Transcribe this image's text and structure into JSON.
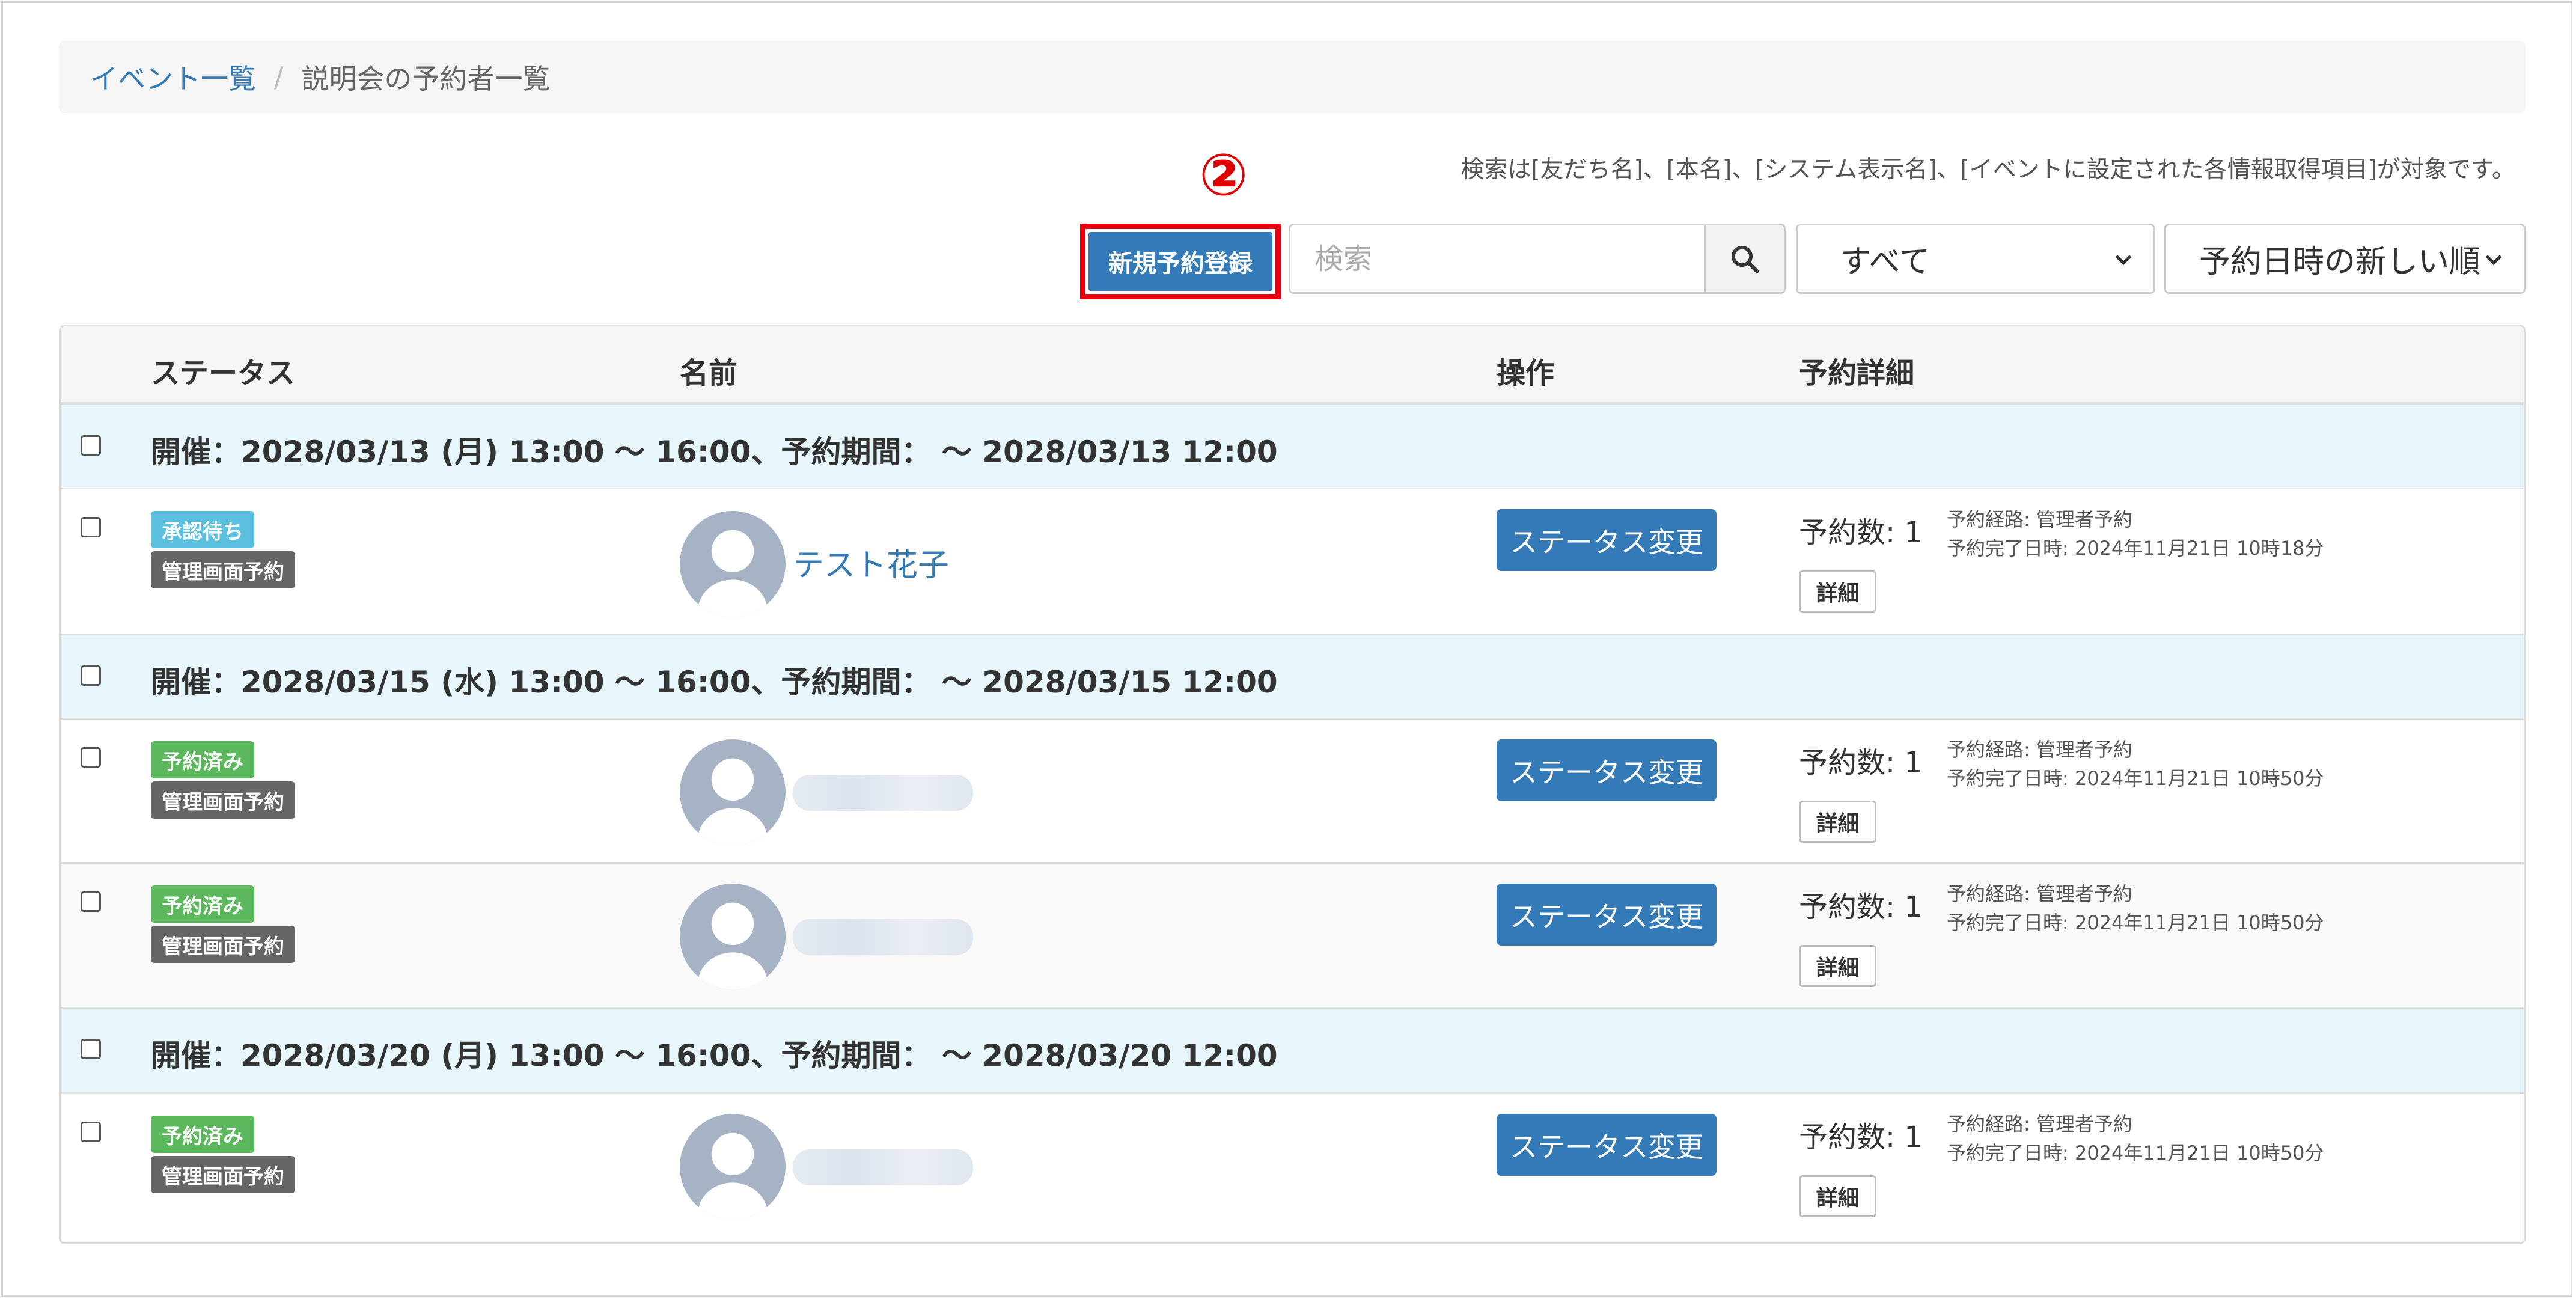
{
  "breadcrumb": {
    "link": "イベント一覧",
    "separator": "/",
    "current": "説明会の予約者一覧"
  },
  "search_note": "検索は[友だち名]、[本名]、[システム表示名]、[イベントに設定された各情報取得項目]が対象です。",
  "annotation_number": "②",
  "toolbar": {
    "new_reservation_label": "新規予約登録",
    "search_placeholder": "検索",
    "status_filter_value": "すべて",
    "sort_value": "予約日時の新しい順"
  },
  "table": {
    "headers": {
      "status": "ステータス",
      "name": "名前",
      "action": "操作",
      "details": "予約詳細"
    },
    "groups": [
      {
        "label": "開催：2028/03/13 (月) 13:00 ～ 16:00、予約期間： ～ 2028/03/13 12:00",
        "rows": [
          {
            "status": "承認待ち",
            "source": "管理画面予約",
            "name": "テスト花子",
            "action": "ステータス変更",
            "count": "予約数: 1",
            "route": "予約経路: 管理者予約",
            "completed": "予約完了日時: 2024年11月21日 10時18分",
            "detail": "詳細"
          }
        ]
      },
      {
        "label": "開催：2028/03/15 (水) 13:00 ～ 16:00、予約期間： ～ 2028/03/15 12:00",
        "rows": [
          {
            "status": "予約済み",
            "source": "管理画面予約",
            "action": "ステータス変更",
            "count": "予約数: 1",
            "route": "予約経路: 管理者予約",
            "completed": "予約完了日時: 2024年11月21日 10時50分",
            "detail": "詳細"
          },
          {
            "status": "予約済み",
            "source": "管理画面予約",
            "action": "ステータス変更",
            "count": "予約数: 1",
            "route": "予約経路: 管理者予約",
            "completed": "予約完了日時: 2024年11月21日 10時50分",
            "detail": "詳細"
          }
        ]
      },
      {
        "label": "開催：2028/03/20 (月) 13:00 ～ 16:00、予約期間： ～ 2028/03/20 12:00",
        "rows": [
          {
            "status": "予約済み",
            "source": "管理画面予約",
            "action": "ステータス変更",
            "count": "予約数: 1",
            "route": "予約経路: 管理者予約",
            "completed": "予約完了日時: 2024年11月21日 10時50分",
            "detail": "詳細"
          }
        ]
      }
    ]
  },
  "colors": {
    "primary": "#337ab7",
    "annotation_red": "#e60012",
    "group_bg": "#e6f6fb",
    "badge_wait": "#5bc0de",
    "badge_done": "#5cb85c",
    "badge_admin": "#666666"
  }
}
